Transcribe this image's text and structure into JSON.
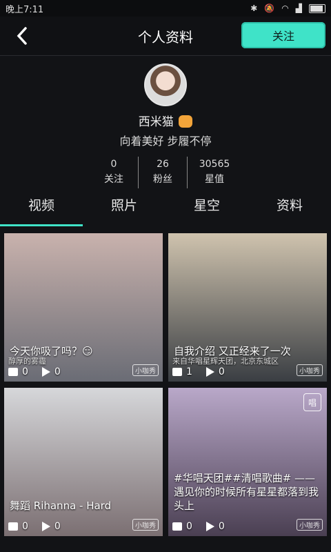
{
  "status_bar": {
    "time": "晚上7:11"
  },
  "header": {
    "title": "个人资料",
    "follow_label": "关注"
  },
  "profile": {
    "name": "西米猫",
    "bio": "向着美好 步履不停",
    "stats": [
      {
        "value": "0",
        "label": "关注"
      },
      {
        "value": "26",
        "label": "粉丝"
      },
      {
        "value": "30565",
        "label": "星值"
      }
    ]
  },
  "tabs": [
    "视频",
    "照片",
    "星空",
    "资料"
  ],
  "active_tab": "视频",
  "videos": [
    {
      "caption": "今天你吸了吗？😏",
      "sub": "醇厚的雾霾",
      "likes": "0",
      "plays": "0",
      "watermark": "小咖秀",
      "colors": [
        "#c9b2ad",
        "#6a6c75"
      ]
    },
    {
      "caption": "自我介绍 又正经来了一次",
      "sub": "来自华唱星辉天团，北京东城区",
      "likes": "1",
      "plays": "0",
      "watermark": "小咖秀",
      "colors": [
        "#cfc3ae",
        "#3a3e43"
      ]
    },
    {
      "caption": "舞蹈 Rihanna - Hard",
      "sub": "",
      "likes": "0",
      "plays": "0",
      "watermark": "小咖秀",
      "colors": [
        "#d6d7da",
        "#7b6f72"
      ]
    },
    {
      "caption": "#华唱天团##清唱歌曲# —— 遇见你的时候所有星星都落到我头上",
      "sub": "",
      "likes": "0",
      "plays": "0",
      "watermark": "小咖秀",
      "badge": "唱",
      "colors": [
        "#b9a8c9",
        "#4a3f52"
      ]
    }
  ],
  "colors": {
    "accent": "#3fe3c8",
    "background": "#121316"
  }
}
